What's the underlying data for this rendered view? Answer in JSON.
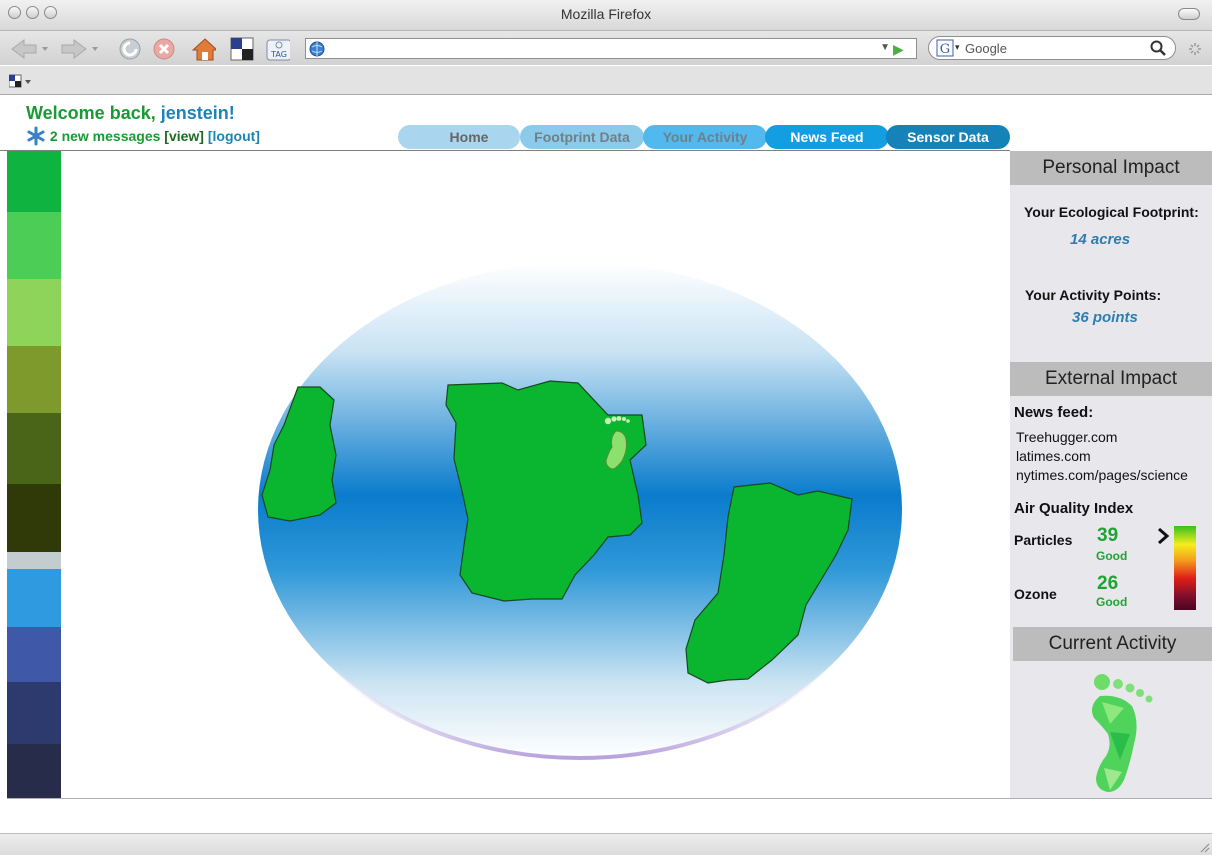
{
  "window": {
    "title": "Mozilla Firefox"
  },
  "toolbar": {
    "url_value": "",
    "search_engine": "Google",
    "search_placeholder": "Google",
    "tag_label": "TAG"
  },
  "header": {
    "welcome_prefix": "Welcome back, ",
    "username": "jenstein!",
    "messages": "2 new messages",
    "view_link": "[view]",
    "logout_link": "[logout]"
  },
  "nav": {
    "tabs": [
      {
        "label": "Home"
      },
      {
        "label": "Footprint Data"
      },
      {
        "label": "Your Activity"
      },
      {
        "label": "News Feed"
      },
      {
        "label": "Sensor Data"
      }
    ]
  },
  "palette": {
    "colors": [
      "#0fb33f",
      "#4ccd55",
      "#8fd45a",
      "#7f9a2c",
      "#4a6418",
      "#2f3a08",
      "#c3cdd0",
      "#2f9ae0",
      "#3f58a8",
      "#2c3a6e",
      "#262c4a"
    ]
  },
  "panel": {
    "personal_header": "Personal Impact",
    "footprint_label": "Your Ecological Footprint:",
    "footprint_value": "14 acres",
    "points_label": "Your Activity Points:",
    "points_value": "36 points",
    "external_header": "External Impact",
    "news_label": "News feed:",
    "news_links": [
      "Treehugger.com",
      "latimes.com",
      "nytimes.com/pages/science"
    ],
    "aqi_label": "Air Quality Index",
    "particles_label": "Particles",
    "particles_value": "39",
    "particles_status": "Good",
    "ozone_label": "Ozone",
    "ozone_value": "26",
    "ozone_status": "Good",
    "activity_header": "Current Activity"
  }
}
